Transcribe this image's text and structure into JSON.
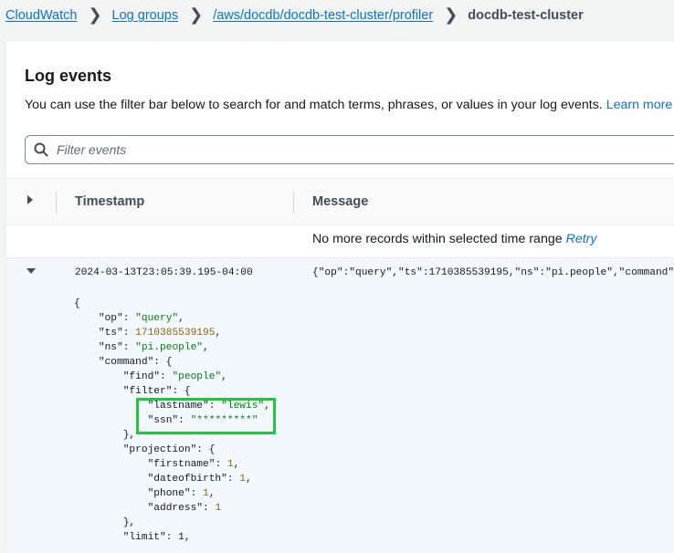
{
  "breadcrumb": {
    "items": [
      "CloudWatch",
      "Log groups",
      "/aws/docdb/docdb-test-cluster/profiler"
    ],
    "current": "docdb-test-cluster",
    "separator": "❯"
  },
  "panel": {
    "title": "Log events",
    "description": "You can use the filter bar below to search for and match terms, phrases, or values in your log events.",
    "learn_more": "Learn more",
    "filter_placeholder": "Filter events"
  },
  "table": {
    "headers": {
      "timestamp": "Timestamp",
      "message": "Message"
    },
    "no_records": "No more records within selected time range",
    "retry": "Retry"
  },
  "event": {
    "timestamp": "2024-03-13T23:05:39.195-04:00",
    "message_preview": "{\"op\":\"query\",\"ts\":1710385539195,\"ns\":\"pi.people\",\"command\":",
    "expanded": true,
    "json_lines": [
      {
        "indent": 0,
        "key": "",
        "value": "",
        "type": "",
        "text": "{"
      },
      {
        "indent": 1,
        "key": "\"op\"",
        "value": "\"query\"",
        "type": "str",
        "text": ","
      },
      {
        "indent": 1,
        "key": "\"ts\"",
        "value": "1710385539195",
        "type": "num",
        "text": ","
      },
      {
        "indent": 1,
        "key": "\"ns\"",
        "value": "\"pi.people\"",
        "type": "str",
        "text": ","
      },
      {
        "indent": 1,
        "key": "\"command\"",
        "value": "",
        "type": "",
        "text": ": {"
      },
      {
        "indent": 2,
        "key": "\"find\"",
        "value": "\"people\"",
        "type": "str",
        "text": ","
      },
      {
        "indent": 2,
        "key": "\"filter\"",
        "value": "",
        "type": "",
        "text": ": {"
      },
      {
        "indent": 3,
        "key": "\"lastname\"",
        "value": "\"lewis\"",
        "type": "str",
        "text": ","
      },
      {
        "indent": 3,
        "key": "\"ssn\"",
        "value": "\"*********\"",
        "type": "str",
        "text": ""
      },
      {
        "indent": 2,
        "key": "",
        "value": "",
        "type": "",
        "text": "},"
      },
      {
        "indent": 2,
        "key": "\"projection\"",
        "value": "",
        "type": "",
        "text": ": {"
      },
      {
        "indent": 3,
        "key": "\"firstname\"",
        "value": "1",
        "type": "num",
        "text": ","
      },
      {
        "indent": 3,
        "key": "\"dateofbirth\"",
        "value": "1",
        "type": "num",
        "text": ","
      },
      {
        "indent": 3,
        "key": "\"phone\"",
        "value": "1",
        "type": "num",
        "text": ","
      },
      {
        "indent": 3,
        "key": "\"address\"",
        "value": "1",
        "type": "num",
        "text": ""
      },
      {
        "indent": 2,
        "key": "",
        "value": "",
        "type": "",
        "text": "},"
      },
      {
        "indent": 2,
        "key": "\"limit\"",
        "value": "",
        "type": "",
        "text": ": 1,"
      }
    ]
  },
  "highlight_color": "#22c53b",
  "colors": {
    "link": "#0972d3",
    "string": "#037f0c",
    "number": "#8d6605"
  }
}
